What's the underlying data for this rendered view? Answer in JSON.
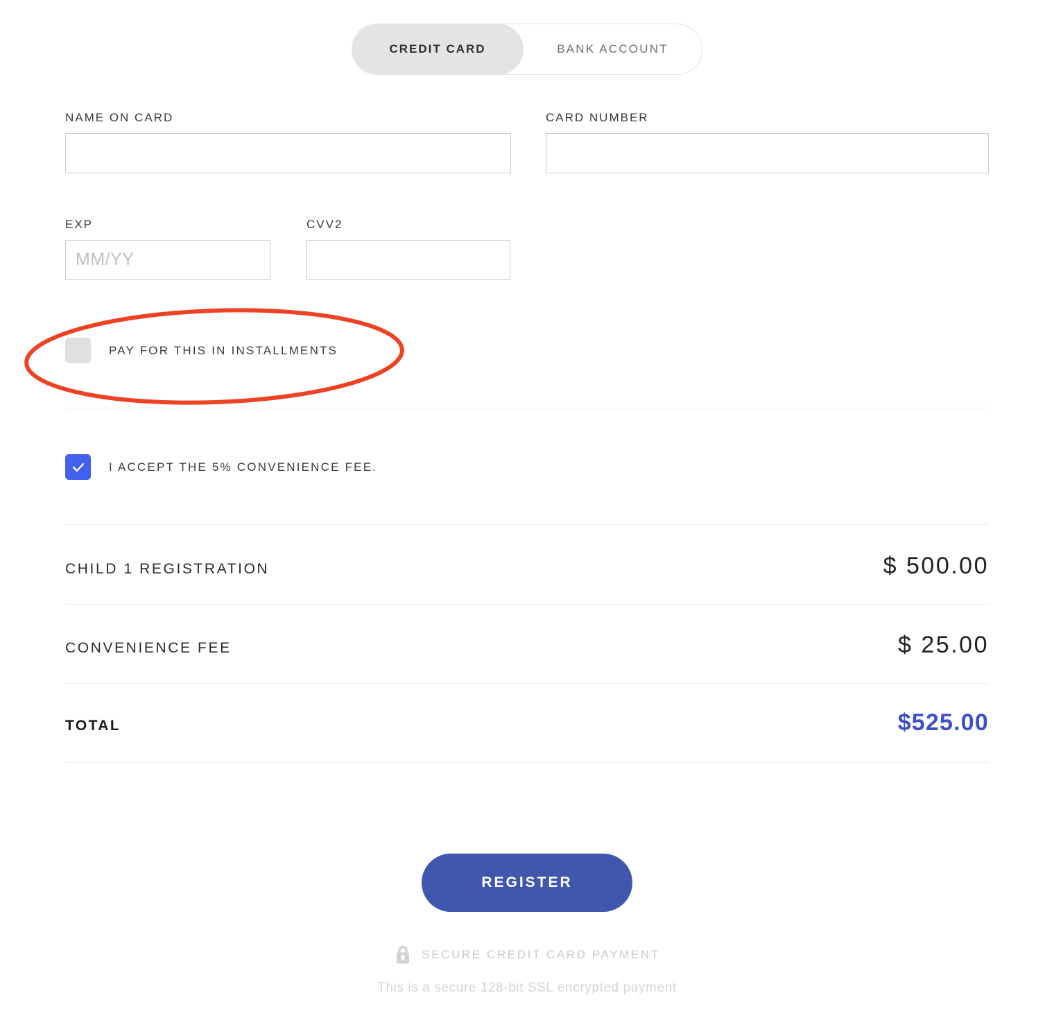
{
  "tabs": [
    {
      "label": "CREDIT CARD",
      "active": true
    },
    {
      "label": "BANK ACCOUNT",
      "active": false
    }
  ],
  "form": {
    "name_on_card": {
      "label": "NAME ON CARD",
      "value": "",
      "placeholder": ""
    },
    "card_number": {
      "label": "CARD NUMBER",
      "value": "",
      "placeholder": ""
    },
    "exp": {
      "label": "EXP",
      "value": "",
      "placeholder": "MM/YY"
    },
    "cvv2": {
      "label": "CVV2",
      "value": "",
      "placeholder": ""
    }
  },
  "options": {
    "installments": {
      "label": "PAY FOR THIS IN INSTALLMENTS",
      "checked": false
    },
    "convenience_fee": {
      "label": "I ACCEPT THE 5% CONVENIENCE FEE.",
      "checked": true
    }
  },
  "summary": {
    "items": [
      {
        "label": "CHILD 1 REGISTRATION",
        "amount": "$ 500.00"
      },
      {
        "label": "CONVENIENCE FEE",
        "amount": "$ 25.00"
      }
    ],
    "total": {
      "label": "TOTAL",
      "amount": "$525.00"
    }
  },
  "actions": {
    "register": "REGISTER"
  },
  "footer": {
    "secure_label": "SECURE CREDIT CARD PAYMENT",
    "ssl_note": "This is a secure 128-bit SSL encrypted payment",
    "lock_icon": "lock-icon"
  },
  "colors": {
    "accent_blue": "#4361ee",
    "button_blue": "#4156ad",
    "total_blue": "#3b51c4",
    "annotation_red": "#ef4123",
    "tab_active_bg": "#e4e4e4"
  }
}
